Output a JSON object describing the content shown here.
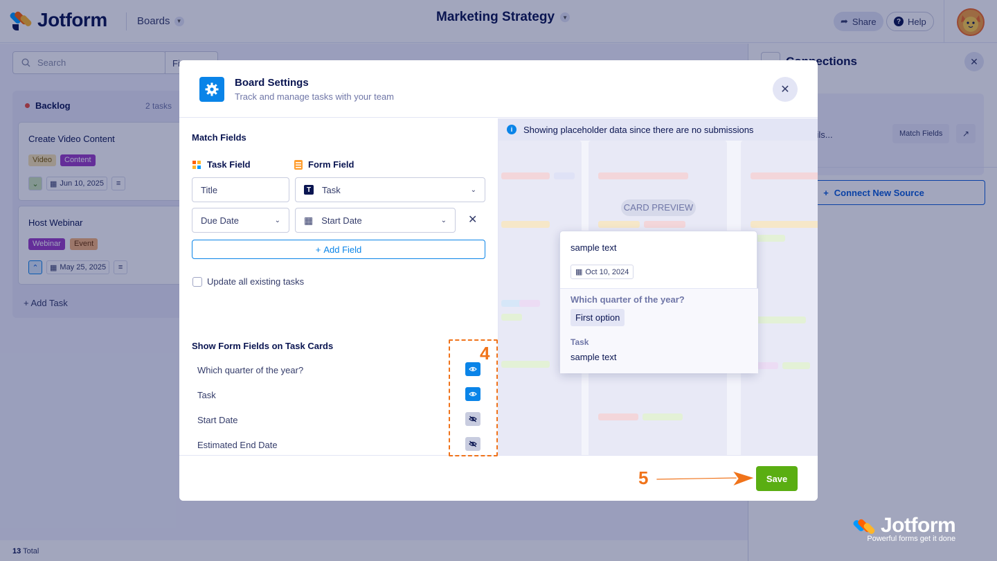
{
  "topbar": {
    "brand": "Jotform",
    "boards_label": "Boards",
    "board_title": "Marketing Strategy",
    "share_label": "Share",
    "help_label": "Help"
  },
  "board": {
    "search_placeholder": "Search",
    "filter_label": "Fi",
    "column": {
      "name": "Backlog",
      "count": "2 tasks",
      "cards": [
        {
          "title": "Create Video Content",
          "tags": [
            "Video",
            "Content"
          ],
          "date": "Jun 10, 2025"
        },
        {
          "title": "Host Webinar",
          "tags": [
            "Webinar",
            "Event"
          ],
          "date": "May 25, 2025"
        }
      ],
      "add_task": "Add Task"
    },
    "total_count": "13",
    "total_label": "Total"
  },
  "connections": {
    "title": "Connections",
    "source_text": "ing Task Details...",
    "match_fields_label": "Match Fields",
    "connect_label": "Connect New Source",
    "watermark_brand": "Jotform",
    "watermark_tagline": "Powerful forms get it done"
  },
  "modal": {
    "title": "Board Settings",
    "subtitle": "Track and manage tasks with your team",
    "match_fields_title": "Match Fields",
    "task_field_header": "Task Field",
    "form_field_header": "Form Field",
    "mappings": [
      {
        "task_field": "Title",
        "form_field": "Task"
      },
      {
        "task_field": "Due Date",
        "form_field": "Start Date"
      }
    ],
    "add_field_label": "Add Field",
    "update_existing_label": "Update all existing tasks",
    "show_fields_title": "Show Form Fields on Task Cards",
    "show_fields": [
      {
        "label": "Which quarter of the year?",
        "visible": true
      },
      {
        "label": "Task",
        "visible": true
      },
      {
        "label": "Start Date",
        "visible": false
      },
      {
        "label": "Estimated End Date",
        "visible": false
      }
    ],
    "banner_text": "Showing placeholder data since there are no submissions",
    "card_preview_label": "CARD PREVIEW",
    "preview": {
      "title": "sample text",
      "date": "Oct 10, 2024",
      "question": "Which quarter of the year?",
      "option": "First option",
      "task_label": "Task",
      "task_value": "sample text"
    },
    "save_label": "Save"
  },
  "annotations": {
    "step_four": "4",
    "step_five": "5",
    "accent": "#f0731a"
  },
  "colors": {
    "brand_blue": "#0a84e8",
    "save_green": "#5aae12",
    "navy": "#0a1551"
  }
}
